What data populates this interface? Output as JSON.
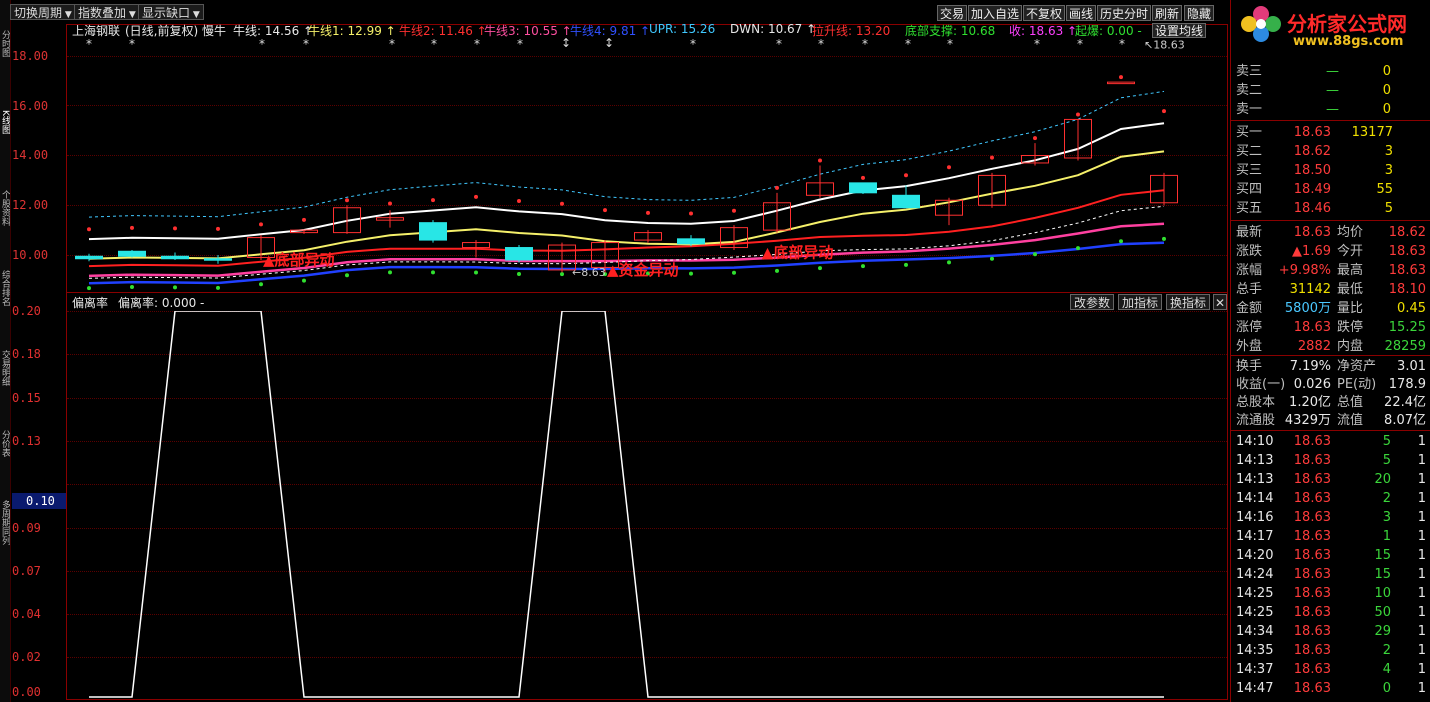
{
  "toolbar": {
    "period_btn": "切换周期",
    "index_btn": "指数叠加",
    "gap_btn": "显示缺口",
    "trade_btn": "交易",
    "watch_btn": "加入自选",
    "norestore_btn": "不复权",
    "draw_btn": "画线",
    "history_btn": "历史分时",
    "refresh_btn": "刷新",
    "hide_btn": "隐藏",
    "ma_btn": "设置均线"
  },
  "logo": {
    "title": "分析家公式网",
    "url": "www.88gs.com"
  },
  "leftbar": [
    "分时图",
    "K线图",
    "个股资料",
    "综合排名",
    "交易明细",
    "分价表",
    "多周期同列"
  ],
  "legend": {
    "stock": "上海钢联",
    "mode": "(日线,前复权)",
    "slow": "慢牛",
    "items": [
      {
        "label": "牛线: 14.56",
        "arrow": "↑",
        "color": "#e8e8e8"
      },
      {
        "label": "牛线1: 12.99",
        "arrow": "↑",
        "color": "#f5f06a"
      },
      {
        "label": "牛线2: 11.46",
        "arrow": "↑",
        "color": "#ff3030"
      },
      {
        "label": "牛线3: 10.55",
        "arrow": "↑",
        "color": "#ff4fa0"
      },
      {
        "label": "牛线4: 9.81",
        "arrow": "↑",
        "color": "#3050ff"
      },
      {
        "label": "UPR: 15.26",
        "arrow": "",
        "color": "#40c8ff"
      },
      {
        "label": "DWN: 10.67",
        "arrow": "↑",
        "color": "#e8e8e8"
      },
      {
        "label": "拉升线: 13.20",
        "arrow": "",
        "color": "#ff3030"
      },
      {
        "label": "底部支撑: 10.68",
        "arrow": "",
        "color": "#30e030"
      },
      {
        "label": "收: 18.63",
        "arrow": "↑",
        "color": "#ff40ff"
      },
      {
        "label": "起爆: 0.00",
        "arrow": "-",
        "color": "#30e030"
      }
    ]
  },
  "price_axis": [
    "18.00",
    "16.00",
    "14.00",
    "12.00",
    "10.00"
  ],
  "price_chart": {
    "candles": [
      {
        "o": 9.95,
        "h": 10.05,
        "l": 9.75,
        "c": 9.85
      },
      {
        "o": 10.15,
        "h": 10.2,
        "l": 9.9,
        "c": 9.95
      },
      {
        "o": 9.95,
        "h": 10.1,
        "l": 9.8,
        "c": 9.85
      },
      {
        "o": 9.85,
        "h": 10.0,
        "l": 9.65,
        "c": 9.8
      },
      {
        "o": 9.9,
        "h": 10.8,
        "l": 9.8,
        "c": 10.7
      },
      {
        "o": 10.9,
        "h": 11.0,
        "l": 10.85,
        "c": 11.0
      },
      {
        "o": 10.9,
        "h": 12.0,
        "l": 10.85,
        "c": 11.9
      },
      {
        "o": 11.4,
        "h": 11.8,
        "l": 11.1,
        "c": 11.5
      },
      {
        "o": 11.3,
        "h": 11.4,
        "l": 10.5,
        "c": 10.6
      },
      {
        "o": 10.3,
        "h": 10.6,
        "l": 9.9,
        "c": 10.5
      },
      {
        "o": 10.3,
        "h": 10.4,
        "l": 9.7,
        "c": 9.8
      },
      {
        "o": 9.4,
        "h": 10.5,
        "l": 9.3,
        "c": 10.4
      },
      {
        "o": 9.5,
        "h": 10.6,
        "l": 9.3,
        "c": 10.5
      },
      {
        "o": 10.6,
        "h": 11.0,
        "l": 10.5,
        "c": 10.9
      },
      {
        "o": 10.65,
        "h": 10.8,
        "l": 10.35,
        "c": 10.45
      },
      {
        "o": 10.3,
        "h": 11.2,
        "l": 10.2,
        "c": 11.1
      },
      {
        "o": 11.0,
        "h": 12.5,
        "l": 10.9,
        "c": 12.1
      },
      {
        "o": 12.4,
        "h": 13.6,
        "l": 12.3,
        "c": 12.9
      },
      {
        "o": 12.9,
        "h": 12.9,
        "l": 12.45,
        "c": 12.5
      },
      {
        "o": 12.4,
        "h": 12.8,
        "l": 11.9,
        "c": 11.9
      },
      {
        "o": 11.6,
        "h": 12.3,
        "l": 11.2,
        "c": 12.2
      },
      {
        "o": 12.0,
        "h": 13.3,
        "l": 11.9,
        "c": 13.2
      },
      {
        "o": 13.7,
        "h": 14.5,
        "l": 13.6,
        "c": 14.0
      },
      {
        "o": 13.9,
        "h": 15.45,
        "l": 13.8,
        "c": 15.45
      },
      {
        "o": 16.95,
        "h": 16.95,
        "l": 16.95,
        "c": 16.95
      },
      {
        "o": 12.1,
        "h": 13.3,
        "l": 12.0,
        "c": 13.2
      }
    ],
    "annotations": [
      "底部异动",
      "资金异动",
      "底部异动"
    ],
    "low_marker": "8.63",
    "high_marker": "18.63"
  },
  "indicator": {
    "name": "偏离率",
    "legend": "偏离率: 0.000",
    "legend_arrow": "-",
    "buttons": [
      "改参数",
      "加指标",
      "换指标"
    ],
    "axis": [
      "0.20",
      "0.18",
      "0.15",
      "0.13",
      "0.10",
      "0.09",
      "0.07",
      "0.04",
      "0.02",
      "0.00"
    ],
    "highlight_label": "0.10"
  },
  "chart_data": {
    "type": "line",
    "title": "偏离率",
    "ylim": [
      0,
      0.2
    ],
    "series": [
      {
        "name": "偏离率",
        "values": [
          0,
          0,
          0.2,
          0.2,
          0.2,
          0,
          0,
          0,
          0,
          0,
          0,
          0.2,
          0.2,
          0,
          0,
          0,
          0,
          0,
          0,
          0,
          0,
          0,
          0,
          0,
          0,
          0
        ]
      }
    ]
  },
  "quote": {
    "sell": [
      {
        "label": "卖三",
        "price": "—",
        "vol": "0"
      },
      {
        "label": "卖二",
        "price": "—",
        "vol": "0"
      },
      {
        "label": "卖一",
        "price": "—",
        "vol": "0"
      }
    ],
    "buy": [
      {
        "label": "买一",
        "price": "18.63",
        "vol": "13177"
      },
      {
        "label": "买二",
        "price": "18.62",
        "vol": "3"
      },
      {
        "label": "买三",
        "price": "18.50",
        "vol": "3"
      },
      {
        "label": "买四",
        "price": "18.49",
        "vol": "55"
      },
      {
        "label": "买五",
        "price": "18.46",
        "vol": "5"
      }
    ],
    "stats": [
      {
        "l1": "最新",
        "v1": "18.63",
        "l2": "均价",
        "v2": "18.62"
      },
      {
        "l1": "涨跌",
        "v1": "▲1.69",
        "l2": "今开",
        "v2": "18.63"
      },
      {
        "l1": "涨幅",
        "v1": "+9.98%",
        "l2": "最高",
        "v2": "18.63"
      },
      {
        "l1": "总手",
        "v1": "31142",
        "l2": "最低",
        "v2": "18.10"
      },
      {
        "l1": "金额",
        "v1": "5800万",
        "l2": "量比",
        "v2": "0.45"
      },
      {
        "l1": "涨停",
        "v1": "18.63",
        "l2": "跌停",
        "v2": "15.25"
      },
      {
        "l1": "外盘",
        "v1": "2882",
        "l2": "内盘",
        "v2": "28259"
      }
    ],
    "finance": [
      {
        "l1": "换手",
        "v1": "7.19%",
        "l2": "净资产",
        "v2": "3.01"
      },
      {
        "l1": "收益(一)",
        "v1": "0.026",
        "l2": "PE(动)",
        "v2": "178.9"
      },
      {
        "l1": "总股本",
        "v1": "1.20亿",
        "l2": "总值",
        "v2": "22.4亿"
      },
      {
        "l1": "流通股",
        "v1": "4329万",
        "l2": "流值",
        "v2": "8.07亿"
      }
    ],
    "ticks": [
      {
        "time": "14:10",
        "price": "18.63",
        "vol": "5",
        "n": "1"
      },
      {
        "time": "14:13",
        "price": "18.63",
        "vol": "5",
        "n": "1"
      },
      {
        "time": "14:13",
        "price": "18.63",
        "vol": "20",
        "n": "1"
      },
      {
        "time": "14:14",
        "price": "18.63",
        "vol": "2",
        "n": "1"
      },
      {
        "time": "14:16",
        "price": "18.63",
        "vol": "3",
        "n": "1"
      },
      {
        "time": "14:17",
        "price": "18.63",
        "vol": "1",
        "n": "1"
      },
      {
        "time": "14:20",
        "price": "18.63",
        "vol": "15",
        "n": "1"
      },
      {
        "time": "14:24",
        "price": "18.63",
        "vol": "15",
        "n": "1"
      },
      {
        "time": "14:25",
        "price": "18.63",
        "vol": "10",
        "n": "1"
      },
      {
        "time": "14:25",
        "price": "18.63",
        "vol": "50",
        "n": "1"
      },
      {
        "time": "14:34",
        "price": "18.63",
        "vol": "29",
        "n": "1"
      },
      {
        "time": "14:35",
        "price": "18.63",
        "vol": "2",
        "n": "1"
      },
      {
        "time": "14:37",
        "price": "18.63",
        "vol": "4",
        "n": "1"
      },
      {
        "time": "14:47",
        "price": "18.63",
        "vol": "0",
        "n": "1"
      }
    ]
  }
}
